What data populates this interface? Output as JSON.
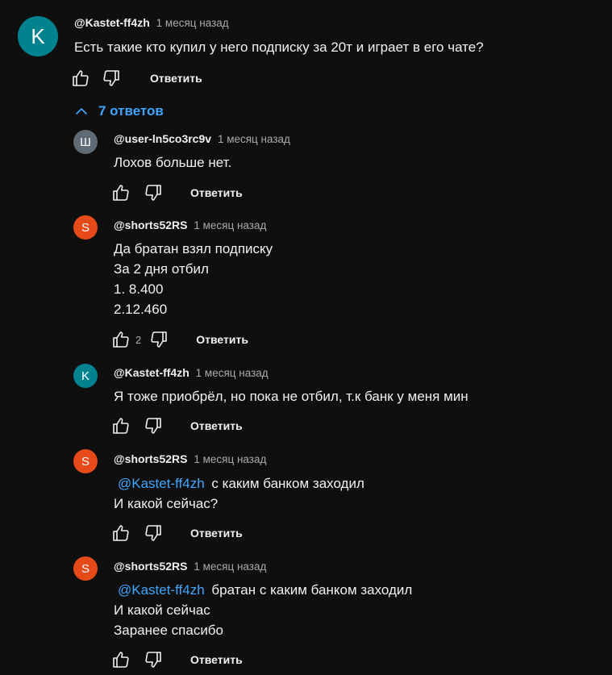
{
  "colors": {
    "background": "#0f0f0f",
    "link": "#3ea6ff",
    "avatar_teal": "#00838f",
    "avatar_orange": "#e64a19",
    "avatar_gray": "#5f6b75"
  },
  "top_comment": {
    "avatar_letter": "K",
    "author": "@Kastet-ff4zh",
    "time": "1 месяц назад",
    "text": "Есть такие кто купил у него подписку за 20т и играет в его чате?",
    "reply_label": "Ответить",
    "like_icon": "thumb-up-icon",
    "dislike_icon": "thumb-down-icon"
  },
  "replies_toggle": {
    "label": "7 ответов",
    "icon": "chevron-up-icon"
  },
  "replies": [
    {
      "avatar_letter": "Ш",
      "author": "@user-ln5co3rc9v",
      "time": "1 месяц назад",
      "lines": [
        "Лохов больше нет."
      ],
      "likes": "",
      "reply_label": "Ответить"
    },
    {
      "avatar_letter": "S",
      "author": "@shorts52RS",
      "time": "1 месяц назад",
      "lines": [
        "Да братан взял подписку",
        "За 2 дня отбил",
        "1. 8.400",
        "2.12.460"
      ],
      "likes": "2",
      "reply_label": "Ответить"
    },
    {
      "avatar_letter": "K",
      "author": "@Kastet-ff4zh",
      "time": "1 месяц назад",
      "lines": [
        "Я тоже приобрёл, но пока не отбил, т.к банк у меня мин"
      ],
      "likes": "",
      "reply_label": "Ответить"
    },
    {
      "avatar_letter": "S",
      "author": "@shorts52RS",
      "time": "1 месяц назад",
      "mention": "@Kastet-ff4zh",
      "first_line_rest": "с каким банком заходил",
      "lines": [
        "И какой сейчас?"
      ],
      "likes": "",
      "reply_label": "Ответить"
    },
    {
      "avatar_letter": "S",
      "author": "@shorts52RS",
      "time": "1 месяц назад",
      "mention": "@Kastet-ff4zh",
      "first_line_rest": "братан с каким банком заходил",
      "lines": [
        "И какой сейчас",
        "Заранее спасибо"
      ],
      "likes": "",
      "reply_label": "Ответить"
    }
  ]
}
